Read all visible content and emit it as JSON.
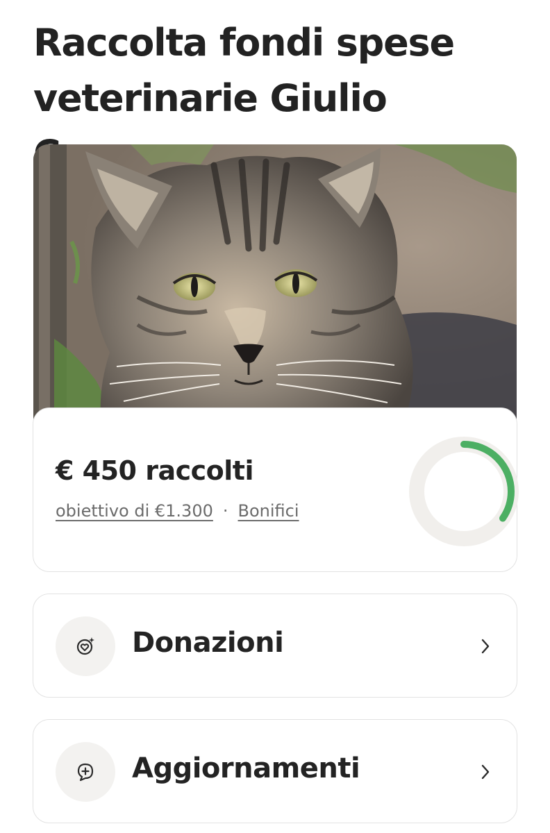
{
  "header": {
    "title_line1": "Raccolta fondi spese",
    "title_line2": "veterinarie Giulio Cesare"
  },
  "hero": {
    "image_subject": "tabby-cat-photo"
  },
  "progress": {
    "raised_text": "€ 450 raccolti",
    "goal_link": "obiettivo di €1.300",
    "separator": "·",
    "transfers_link": "Bonifici",
    "raised_amount": 450,
    "goal_amount": 1300,
    "fraction": 0.346,
    "ring_color": "#4caf63",
    "ring_track_color": "#f1efec"
  },
  "sections": {
    "donations": {
      "label": "Donazioni",
      "icon": "heart-sparkle-icon"
    },
    "updates": {
      "label": "Aggiornamenti",
      "icon": "chat-plus-icon"
    }
  }
}
